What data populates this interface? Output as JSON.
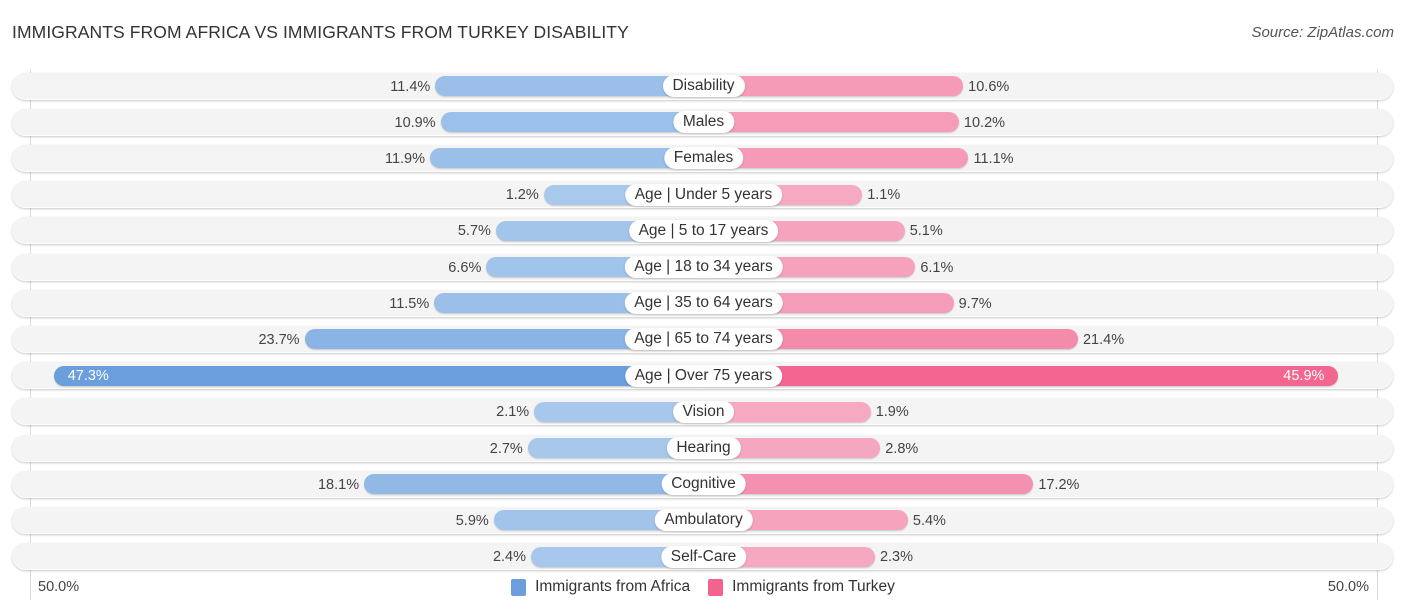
{
  "title": "IMMIGRANTS FROM AFRICA VS IMMIGRANTS FROM TURKEY DISABILITY",
  "source": "Source: ZipAtlas.com",
  "chart_data": {
    "type": "bar",
    "orientation": "horizontal-diverging",
    "title": "IMMIGRANTS FROM AFRICA VS IMMIGRANTS FROM TURKEY DISABILITY",
    "categories": [
      "Disability",
      "Males",
      "Females",
      "Age | Under 5 years",
      "Age | 5 to 17 years",
      "Age | 18 to 34 years",
      "Age | 35 to 64 years",
      "Age | 65 to 74 years",
      "Age | Over 75 years",
      "Vision",
      "Hearing",
      "Cognitive",
      "Ambulatory",
      "Self-Care"
    ],
    "series": [
      {
        "name": "Immigrants from Africa",
        "side": "left",
        "color": "#6a9edd",
        "color_light": "#a9c9ec",
        "values": [
          11.4,
          10.9,
          11.9,
          1.2,
          5.7,
          6.6,
          11.5,
          23.7,
          47.3,
          2.1,
          2.7,
          18.1,
          5.9,
          2.4
        ],
        "value_labels": [
          "11.4%",
          "10.9%",
          "11.9%",
          "1.2%",
          "5.7%",
          "6.6%",
          "11.5%",
          "23.7%",
          "47.3%",
          "2.1%",
          "2.7%",
          "18.1%",
          "5.9%",
          "2.4%"
        ]
      },
      {
        "name": "Immigrants from Turkey",
        "side": "right",
        "color": "#f2648f",
        "color_light": "#f6aac2",
        "values": [
          10.6,
          10.2,
          11.1,
          1.1,
          5.1,
          6.1,
          9.7,
          21.4,
          45.9,
          1.9,
          2.8,
          17.2,
          5.4,
          2.3
        ],
        "value_labels": [
          "10.6%",
          "10.2%",
          "11.1%",
          "1.1%",
          "5.1%",
          "6.1%",
          "9.7%",
          "21.4%",
          "45.9%",
          "1.9%",
          "2.8%",
          "17.2%",
          "5.4%",
          "2.3%"
        ]
      }
    ],
    "axis": {
      "range": [
        -50,
        50
      ],
      "unit": "%",
      "left_label": "50.0%",
      "right_label": "50.0%"
    },
    "legend_position": "bottom-center",
    "grid": false
  }
}
